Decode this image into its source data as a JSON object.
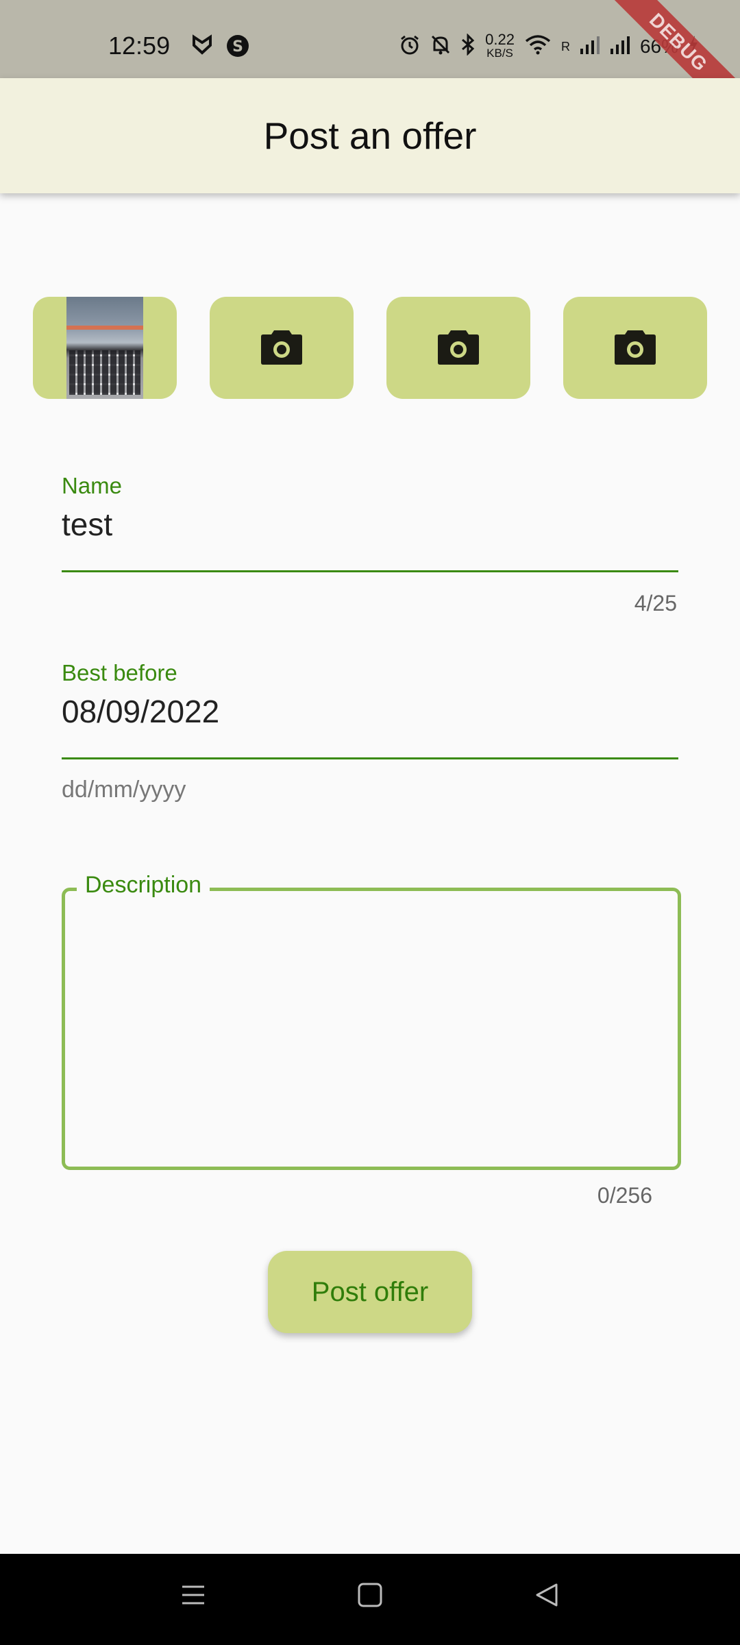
{
  "status_bar": {
    "time": "12:59",
    "net_speed_value": "0.22",
    "net_speed_unit": "KB/S",
    "roaming": "R",
    "battery": "66%",
    "debug_banner": "DEBUG",
    "icons": [
      "vpn-icon",
      "s-app-icon",
      "alarm-icon",
      "mute-icon",
      "bluetooth-icon",
      "wifi-icon",
      "signal-icon",
      "signal-icon",
      "charging-icon"
    ]
  },
  "app_bar": {
    "title": "Post an offer"
  },
  "photos": {
    "slots": [
      {
        "type": "thumbnail"
      },
      {
        "type": "camera",
        "icon": "camera-icon"
      },
      {
        "type": "camera",
        "icon": "camera-icon"
      },
      {
        "type": "camera",
        "icon": "camera-icon"
      }
    ]
  },
  "form": {
    "name": {
      "label": "Name",
      "value": "test",
      "counter": "4/25"
    },
    "best_before": {
      "label": "Best before",
      "value": "08/09/2022",
      "helper": "dd/mm/yyyy"
    },
    "description": {
      "label": "Description",
      "value": "",
      "counter": "0/256"
    }
  },
  "actions": {
    "post_label": "Post offer"
  },
  "nav_bar": {
    "icons": [
      "menu-icon",
      "home-icon",
      "back-icon"
    ]
  },
  "colors": {
    "accent": "#3a8a10",
    "chip": "#cdd886",
    "app_bar": "#f2f1de",
    "outline": "#8dbc55"
  }
}
